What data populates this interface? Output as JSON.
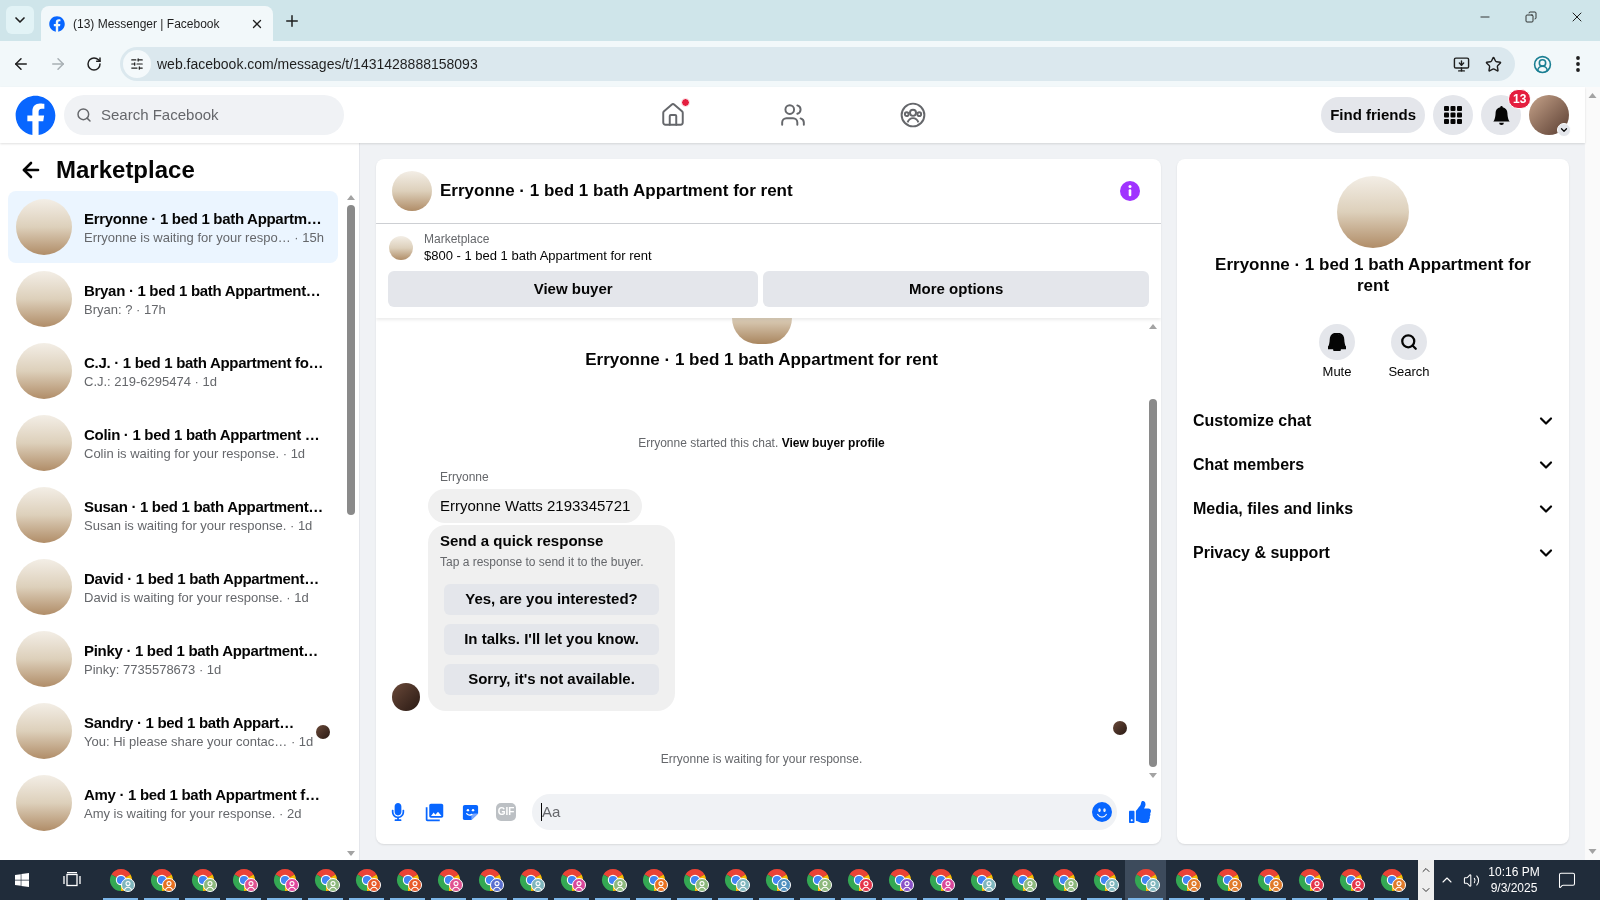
{
  "browser": {
    "tabs": [
      {
        "title": "(13) Messenger | Facebook",
        "selected": true
      }
    ],
    "back_enabled": true,
    "forward_enabled": false,
    "url": "web.facebook.com/messages/t/1431428888158093"
  },
  "facebook_header": {
    "search_placeholder": "Search Facebook",
    "nav_items": [
      {
        "kind": "home",
        "dot": true
      },
      {
        "kind": "friends",
        "dot": false
      },
      {
        "kind": "groups",
        "dot": false
      }
    ],
    "find_friends": "Find friends",
    "notification_count": "13"
  },
  "sidebar": {
    "title": "Marketplace",
    "conversations": [
      {
        "title": "Erryonne · 1 bed 1 bath Appartm…",
        "preview": "Erryonne is waiting for your respo… · 15h",
        "selected": true,
        "seen": false
      },
      {
        "title": "Bryan · 1 bed 1 bath Appartment…",
        "preview": "Bryan: ? · 17h",
        "selected": false,
        "seen": false
      },
      {
        "title": "C.J. · 1 bed 1 bath Appartment fo…",
        "preview": "C.J.: 219-6295474 · 1d",
        "selected": false,
        "seen": false
      },
      {
        "title": "Colin · 1 bed 1 bath Appartment …",
        "preview": "Colin is waiting for your response. · 1d",
        "selected": false,
        "seen": false
      },
      {
        "title": "Susan · 1 bed 1 bath Appartment…",
        "preview": "Susan is waiting for your response. · 1d",
        "selected": false,
        "seen": false
      },
      {
        "title": "David · 1 bed 1 bath Appartment…",
        "preview": "David is waiting for your response. · 1d",
        "selected": false,
        "seen": false
      },
      {
        "title": "Pinky · 1 bed 1 bath Appartment…",
        "preview": "Pinky: 7735578673 · 1d",
        "selected": false,
        "seen": false
      },
      {
        "title": "Sandry · 1 bed 1 bath Appart…",
        "preview": "You: Hi please share your contac… · 1d",
        "selected": false,
        "seen": true
      },
      {
        "title": "Amy · 1 bed 1 bath Appartment f…",
        "preview": "Amy is waiting for your response. · 2d",
        "selected": false,
        "seen": false
      }
    ]
  },
  "chat": {
    "title": "Erryonne · 1 bed 1 bath Appartment for rent",
    "listing": {
      "label": "Marketplace",
      "text": "$800 - 1 bed 1 bath Appartment for rent"
    },
    "actions": [
      "View buyer",
      "More options"
    ],
    "intro_title": "Erryonne · 1 bed 1 bath Appartment for rent",
    "started_text": "Erryonne started this chat.",
    "started_link": "View buyer profile",
    "sender": "Erryonne",
    "messages": [
      {
        "kind": "text",
        "text": "Erryonne Watts 2193345721"
      },
      {
        "kind": "quick_responses",
        "title": "Send a quick response",
        "subtitle": "Tap a response to send it to the buyer.",
        "options": [
          "Yes, are you interested?",
          "In talks. I'll let you know.",
          "Sorry, it's not available."
        ]
      }
    ],
    "seen": true,
    "status": "Erryonne is waiting for your response.",
    "composer": {
      "gif_label": "GIF",
      "placeholder": "Aa",
      "focused": true
    }
  },
  "details": {
    "title": "Erryonne · 1 bed 1 bath Appartment for rent",
    "actions": [
      {
        "kind": "mute",
        "label": "Mute"
      },
      {
        "kind": "search",
        "label": "Search"
      }
    ],
    "sections": [
      {
        "label": "Customize chat",
        "expanded": false
      },
      {
        "label": "Chat members",
        "expanded": false
      },
      {
        "label": "Media, files and links",
        "expanded": false
      },
      {
        "label": "Privacy & support",
        "expanded": false
      }
    ]
  },
  "taskbar": {
    "apps": [
      {
        "selected": false,
        "color": "#7fb6bd"
      },
      {
        "selected": false,
        "color": "#e8701f"
      },
      {
        "selected": false,
        "color": "#8cb87c"
      },
      {
        "selected": false,
        "color": "#e05291"
      },
      {
        "selected": false,
        "color": "#e0489d"
      },
      {
        "selected": false,
        "color": "#8cb87c"
      },
      {
        "selected": false,
        "color": "#e85a2a"
      },
      {
        "selected": false,
        "color": "#e85a2a"
      },
      {
        "selected": false,
        "color": "#e05291"
      },
      {
        "selected": false,
        "color": "#5a6fcf"
      },
      {
        "selected": false,
        "color": "#7fb6bd"
      },
      {
        "selected": false,
        "color": "#d9479a"
      },
      {
        "selected": false,
        "color": "#8cb87c"
      },
      {
        "selected": false,
        "color": "#e8701f"
      },
      {
        "selected": false,
        "color": "#8cb87c"
      },
      {
        "selected": false,
        "color": "#7fb6bd"
      },
      {
        "selected": false,
        "color": "#4f8fbf"
      },
      {
        "selected": false,
        "color": "#8cb87c"
      },
      {
        "selected": false,
        "color": "#e5344a"
      },
      {
        "selected": false,
        "color": "#8a52c8"
      },
      {
        "selected": false,
        "color": "#d9479a"
      },
      {
        "selected": false,
        "color": "#7fb6bd"
      },
      {
        "selected": false,
        "color": "#8cb87c"
      },
      {
        "selected": false,
        "color": "#8cb87c"
      },
      {
        "selected": false,
        "color": "#7fb6bd"
      },
      {
        "selected": true,
        "color": "#7fb6bd"
      },
      {
        "selected": false,
        "color": "#e07a2a"
      },
      {
        "selected": false,
        "color": "#e07a2a"
      },
      {
        "selected": false,
        "color": "#e07a2a"
      },
      {
        "selected": false,
        "color": "#e5344a"
      },
      {
        "selected": false,
        "color": "#e5344a"
      },
      {
        "selected": false,
        "color": "#e07a2a"
      }
    ],
    "time": "10:16 PM",
    "date": "9/3/2025"
  }
}
